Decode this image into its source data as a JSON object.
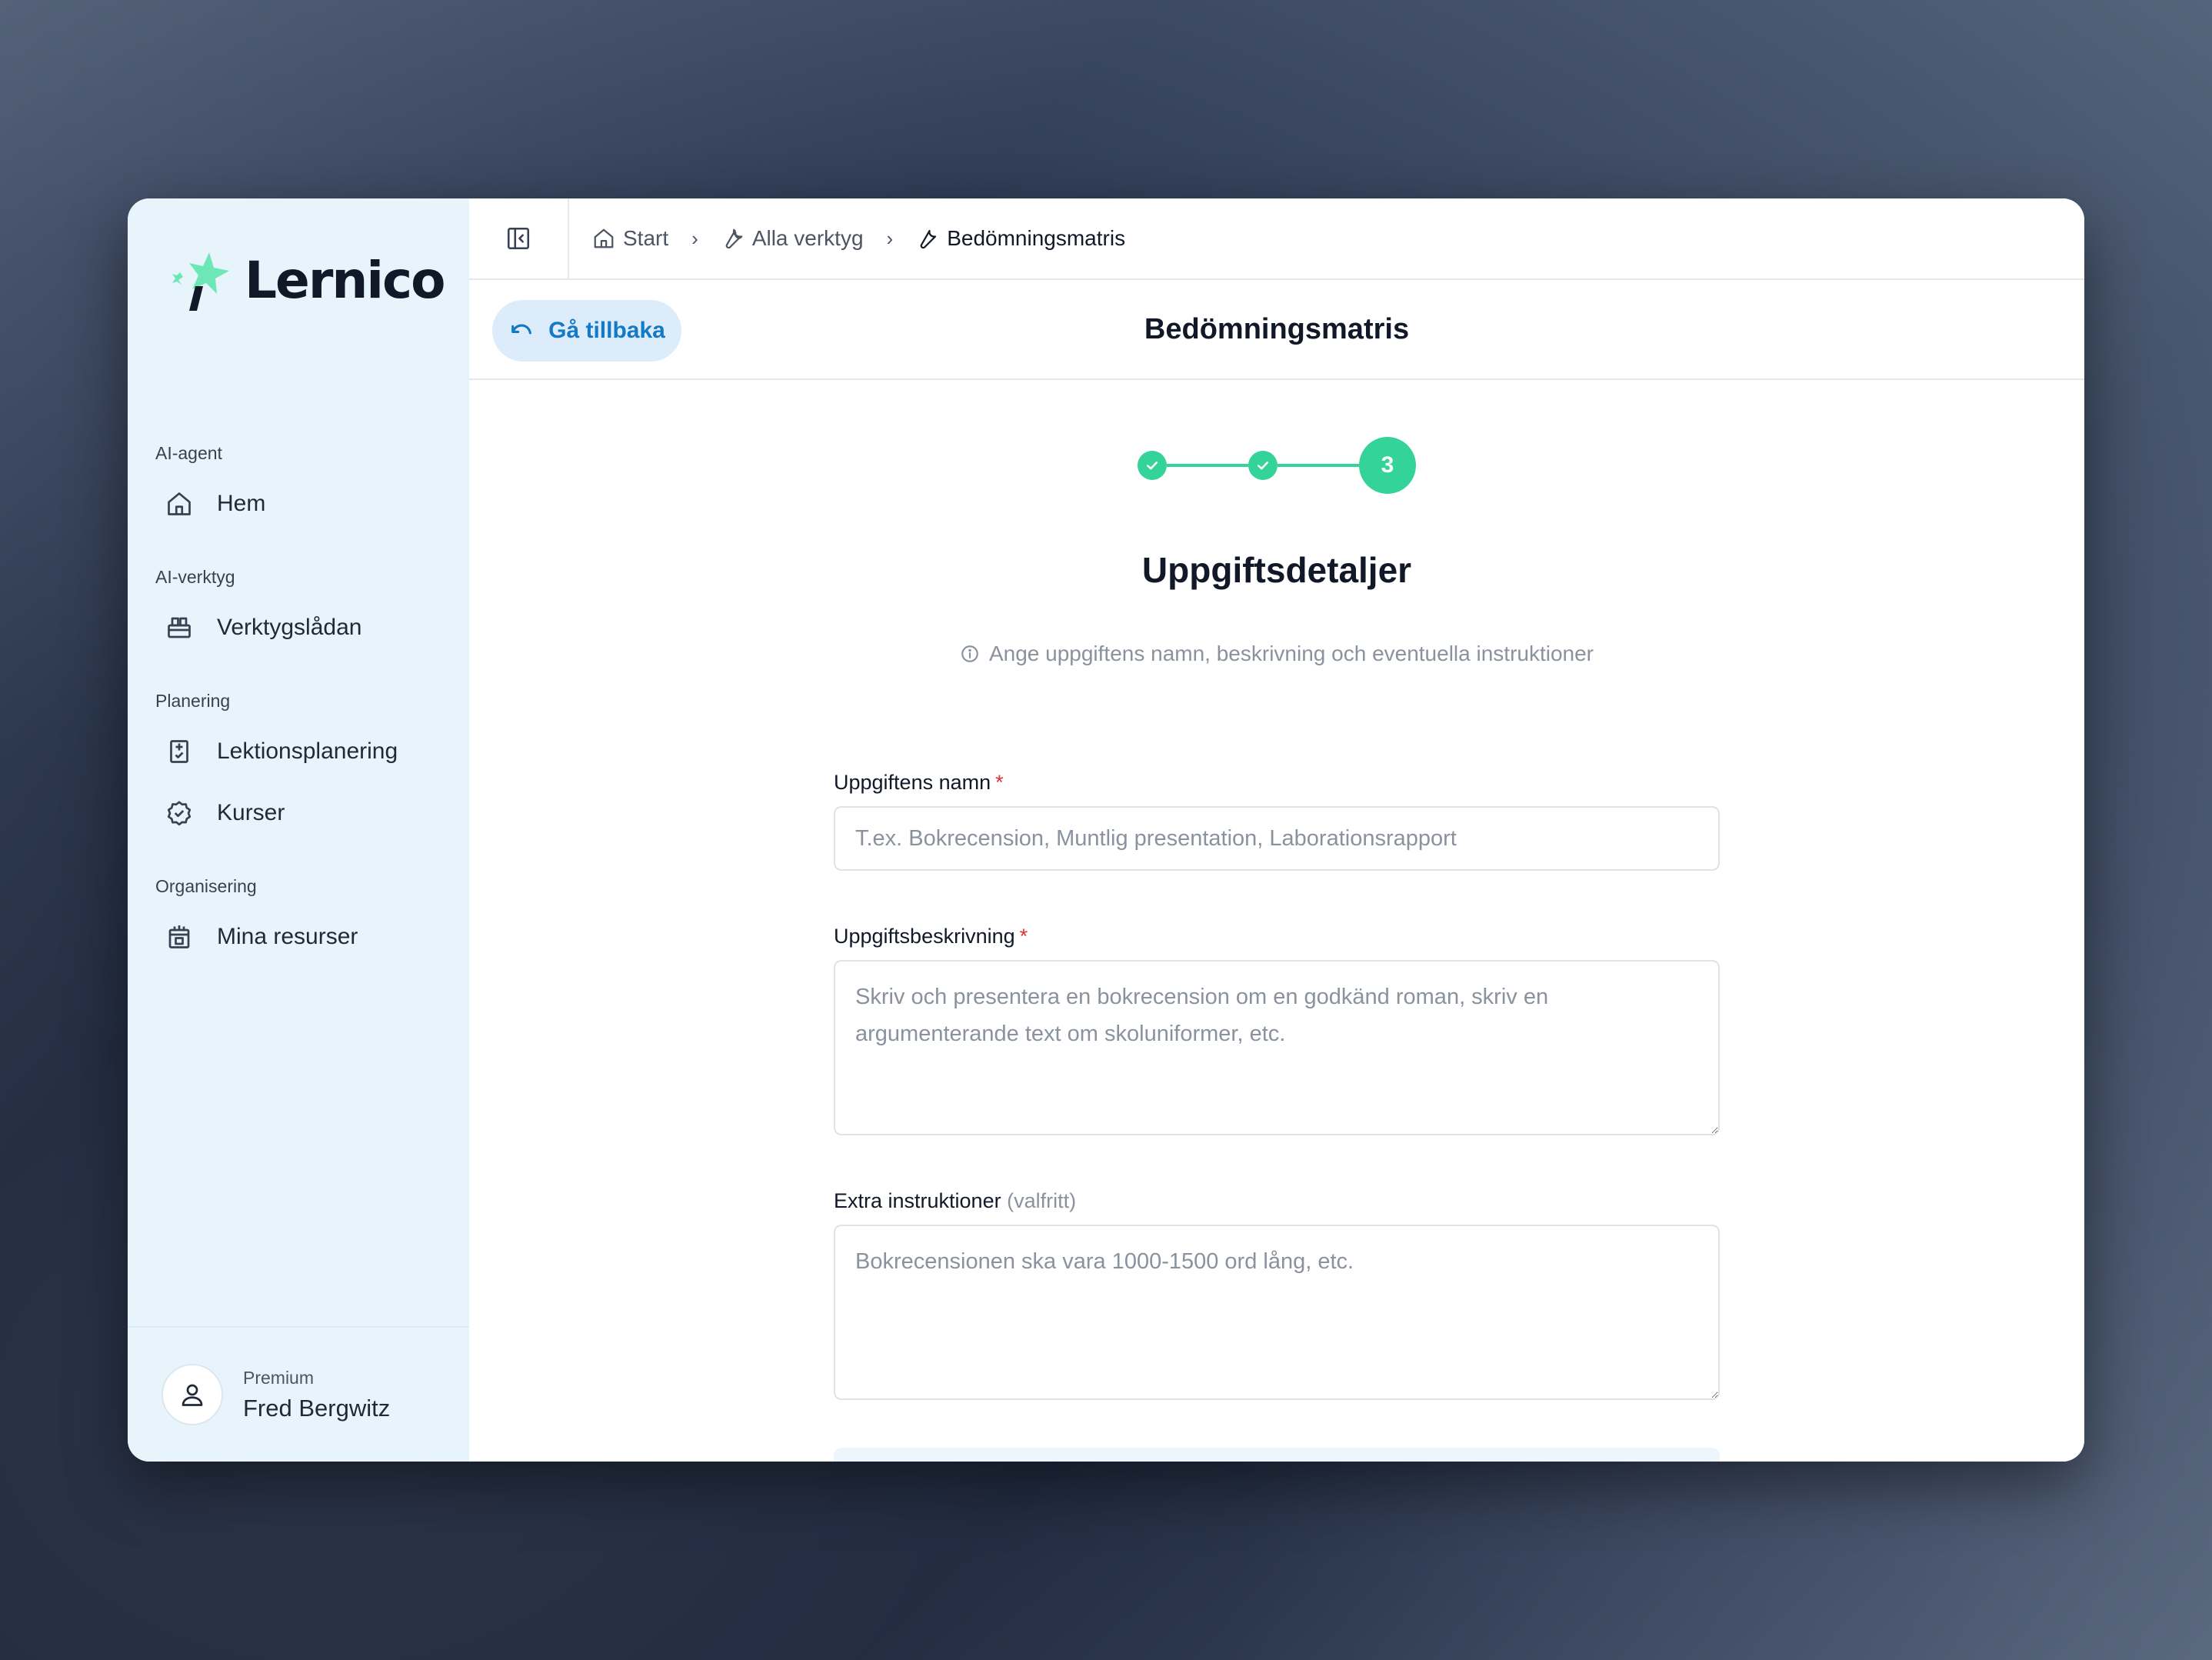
{
  "brand": {
    "name": "Lernico"
  },
  "sidebar": {
    "sections": [
      {
        "label": "AI-agent",
        "items": [
          {
            "label": "Hem",
            "icon": "home-icon"
          }
        ]
      },
      {
        "label": "AI-verktyg",
        "items": [
          {
            "label": "Verktygslådan",
            "icon": "toolbox-icon"
          }
        ]
      },
      {
        "label": "Planering",
        "items": [
          {
            "label": "Lektionsplanering",
            "icon": "lesson-plan-icon"
          },
          {
            "label": "Kurser",
            "icon": "badge-check-icon"
          }
        ]
      },
      {
        "label": "Organisering",
        "items": [
          {
            "label": "Mina resurser",
            "icon": "calendar-resources-icon"
          }
        ]
      }
    ],
    "user": {
      "tier": "Premium",
      "name": "Fred Bergwitz"
    }
  },
  "breadcrumb": {
    "start": "Start",
    "all_tools": "Alla verktyg",
    "current": "Bedömningsmatris"
  },
  "header": {
    "back_label": "Gå tillbaka",
    "title": "Bedömningsmatris"
  },
  "stepper": {
    "current_step": "3",
    "completed_steps": 2
  },
  "section": {
    "title": "Uppgiftsdetaljer",
    "hint": "Ange uppgiftens namn, beskrivning och eventuella instruktioner"
  },
  "form": {
    "name": {
      "label": "Uppgiftens namn",
      "required_mark": "*",
      "placeholder": "T.ex. Bokrecension, Muntlig presentation, Laborationsrapport",
      "value": ""
    },
    "description": {
      "label": "Uppgiftsbeskrivning",
      "required_mark": "*",
      "placeholder": "Skriv och presentera en bokrecension om en godkänd roman, skriv en argumenterande text om skoluniformer, etc.",
      "value": ""
    },
    "instructions": {
      "label": "Extra instruktioner",
      "optional_mark": "(valfritt)",
      "placeholder": "Bokrecensionen ska vara 1000-1500 ord lång, etc.",
      "value": ""
    }
  },
  "colors": {
    "accent_green": "#34d399",
    "link_blue": "#1479c7",
    "sidebar_bg": "#e8f4fc",
    "required_red": "#e03131"
  }
}
